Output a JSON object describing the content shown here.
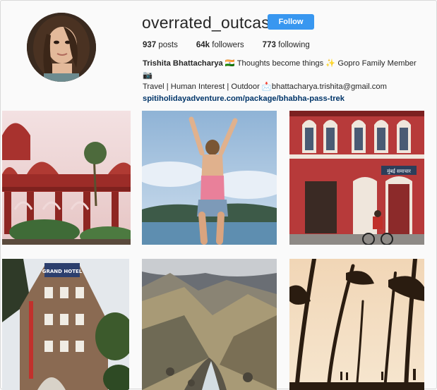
{
  "profile": {
    "username": "overrated_outcast",
    "follow_label": "Follow",
    "posts_count": "937",
    "posts_label": "posts",
    "followers_count": "64k",
    "followers_label": "followers",
    "following_count": "773",
    "following_label": "following",
    "full_name": "Trishita Bhattacharya",
    "bio_line1": " 🇮🇳 Thoughts become things ✨ Gopro Family Member 📷",
    "bio_line2": "Travel | Human Interest | Outdoor 📩bhattacharya.trishita@gmail.com",
    "website": "spitiholidayadventure.com/package/bhabha-pass-trek"
  },
  "colors": {
    "follow_button": "#3897f0",
    "link": "#003569"
  },
  "posts": [
    {
      "subject": "red palace domes with palm trees"
    },
    {
      "subject": "woman jumping at seashore"
    },
    {
      "subject": "red heritage building with cyclist"
    },
    {
      "subject": "corner hotel building"
    },
    {
      "subject": "mountain valley stream"
    },
    {
      "subject": "silhouette trees at sunset"
    }
  ],
  "signboard_text": "मुंबई समाचार",
  "hotel_sign_text": "GRAND HOTEL"
}
